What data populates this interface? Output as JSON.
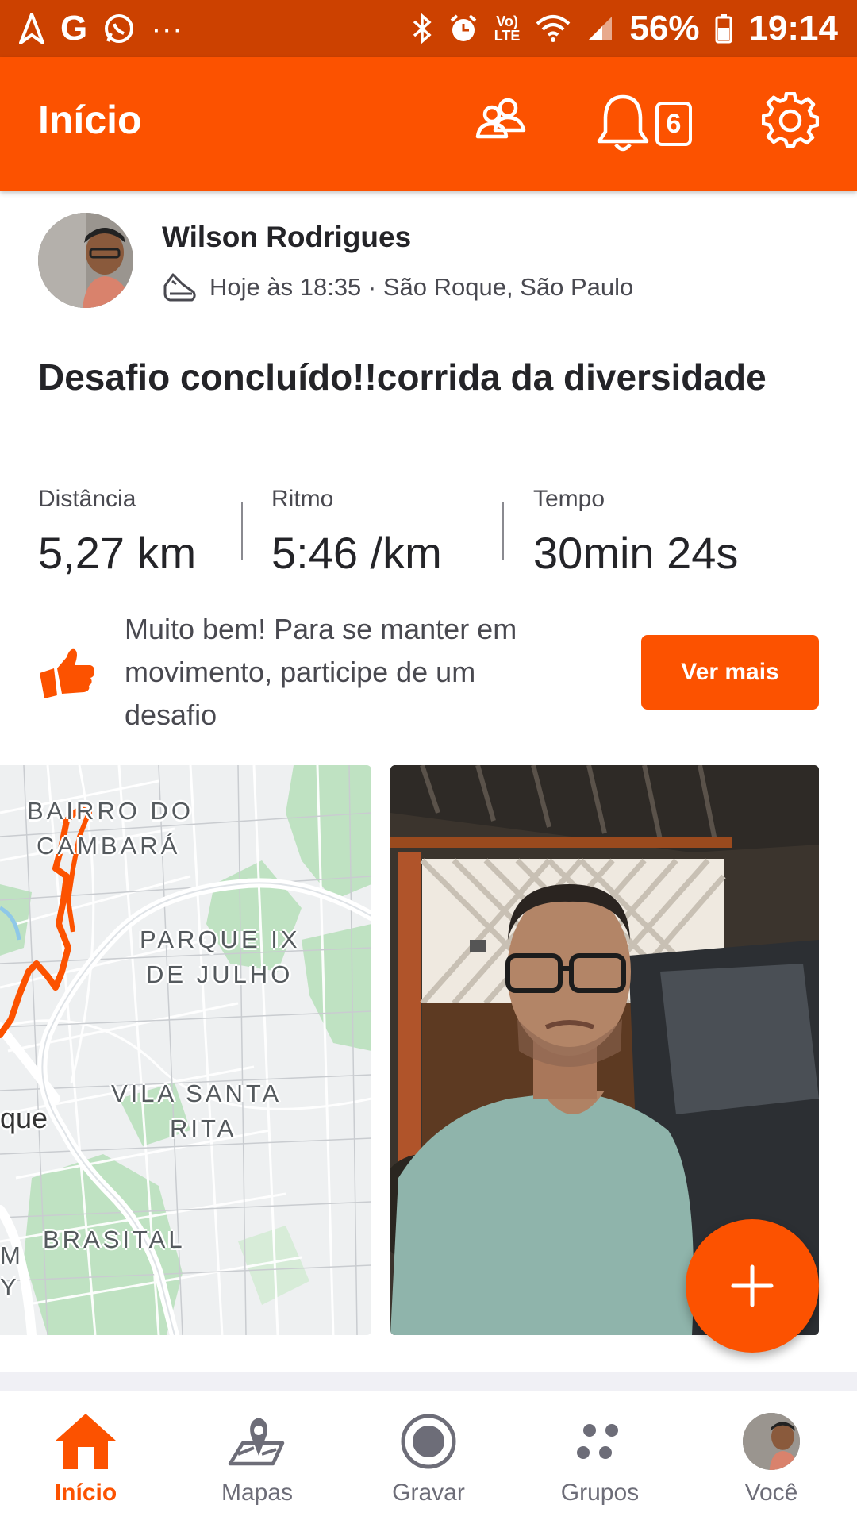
{
  "status_bar": {
    "carrier_icon": "G",
    "battery_percent": "56%",
    "time": "19:14",
    "network": "LTE"
  },
  "header": {
    "title": "Início",
    "notification_count": "6"
  },
  "post": {
    "athlete_name": "Wilson Rodrigues",
    "meta": "Hoje às 18:35 · São Roque, São Paulo",
    "activity_icon": "running-shoe-icon",
    "title": "Desafio concluído!!corrida da diversidade",
    "stats": [
      {
        "label": "Distância",
        "value": "5,27 km"
      },
      {
        "label": "Ritmo",
        "value": "5:46 /km"
      },
      {
        "label": "Tempo",
        "value": "30min 24s"
      }
    ],
    "promo": {
      "text": "Muito bem! Para se manter em movimento, participe de um desafio",
      "button_label": "Ver mais"
    },
    "map_labels": {
      "l1": "BAIRRO DO",
      "l2": "CAMBARÁ",
      "l3": "PARQUE IX",
      "l4": "DE JULHO",
      "l5": "VILA SANTA",
      "l6": "RITA",
      "l7": "que",
      "l8": "BRASITAL",
      "l9": "M",
      "l10": "Y"
    }
  },
  "bottom_nav": [
    {
      "label": "Início",
      "icon": "home-icon",
      "active": true
    },
    {
      "label": "Mapas",
      "icon": "map-icon",
      "active": false
    },
    {
      "label": "Gravar",
      "icon": "record-icon",
      "active": false
    },
    {
      "label": "Grupos",
      "icon": "groups-icon",
      "active": false
    },
    {
      "label": "Você",
      "icon": "profile-avatar",
      "active": false
    }
  ],
  "colors": {
    "brand": "#fc5200",
    "status_bar": "#cc4100",
    "text_primary": "#242428",
    "text_secondary": "#494950"
  }
}
